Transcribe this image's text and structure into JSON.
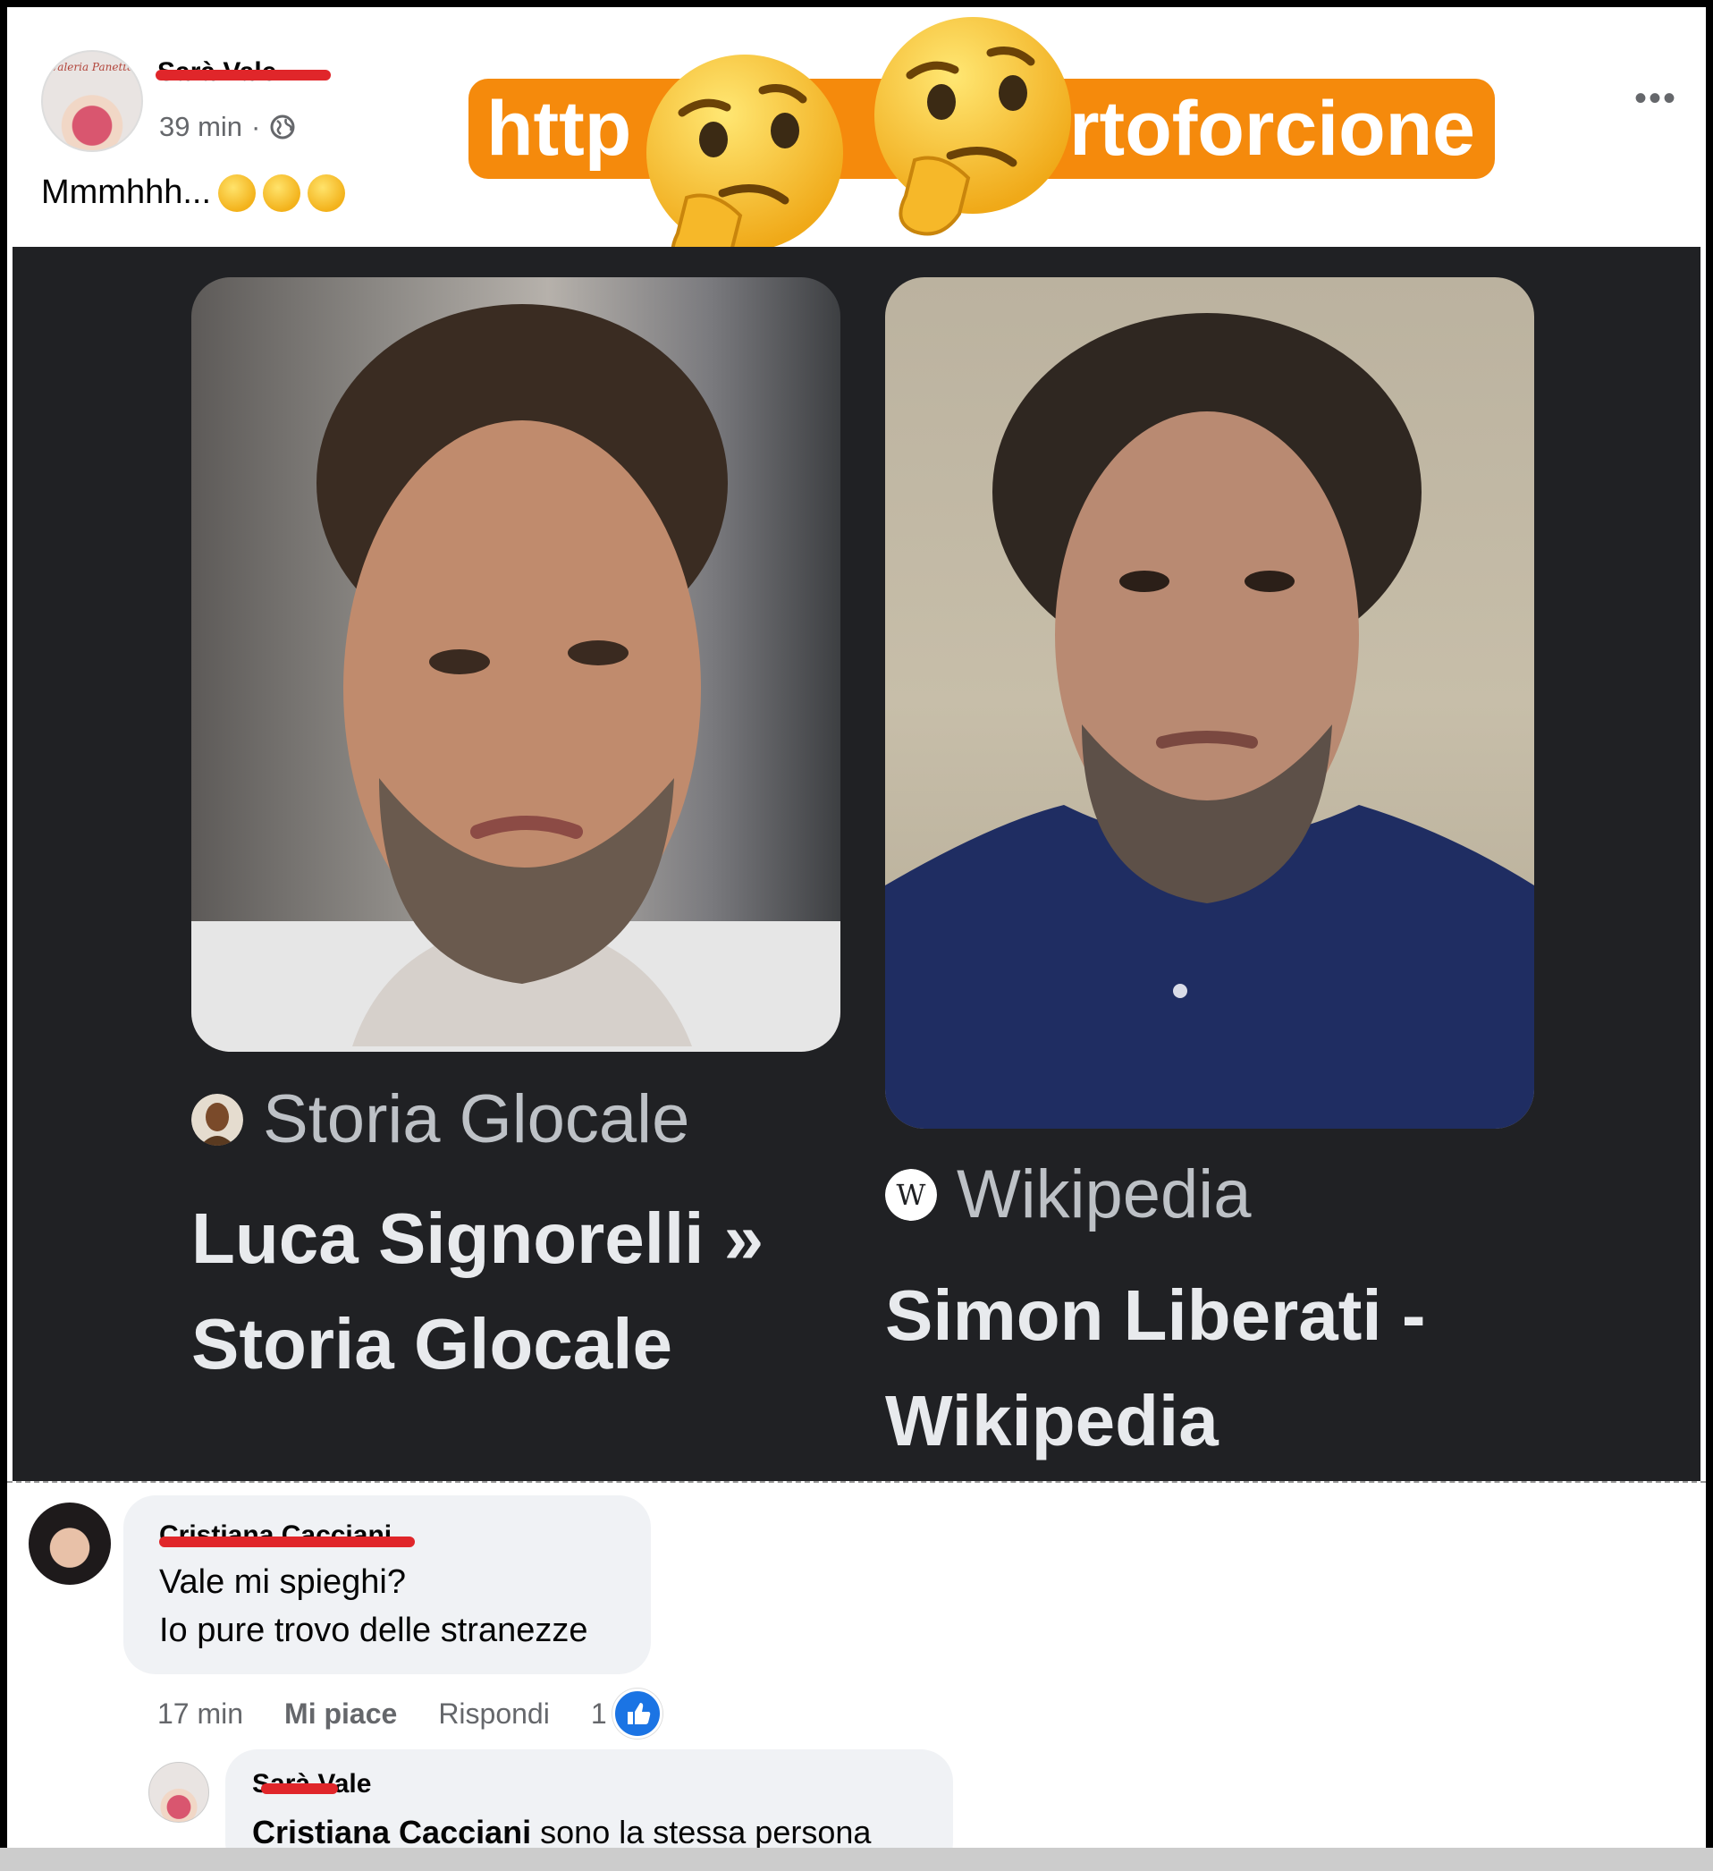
{
  "post": {
    "author": "Sarà Vale",
    "avatar_text": "Valeria Panetta",
    "time": "39 min",
    "separator": "·",
    "text": "Mmmhhh...",
    "url_left": "http",
    "url_right": "rtoforcione",
    "more_label": "•••"
  },
  "cards": [
    {
      "source": "Storia Glocale",
      "title_line1": "Luca Signorelli »",
      "title_line2": "Storia Glocale"
    },
    {
      "source": "Wikipedia",
      "title_line1": "Simon Liberati -",
      "title_line2": "Wikipedia"
    }
  ],
  "comments": [
    {
      "author": "Cristiana Cacciani",
      "line1": "Vale mi spieghi?",
      "line2": "Io pure trovo delle stranezze",
      "time": "17 min",
      "like_label": "Mi piace",
      "reply_label": "Rispondi",
      "reaction_count": "1"
    },
    {
      "author": "Sarà Vale",
      "mention": "Cristiana Cacciani",
      "text": "sono la stessa persona"
    }
  ],
  "colors": {
    "banner": "#f58a0c",
    "card_bg": "#202124",
    "redaction": "#e0262a",
    "like": "#1b74e4"
  }
}
